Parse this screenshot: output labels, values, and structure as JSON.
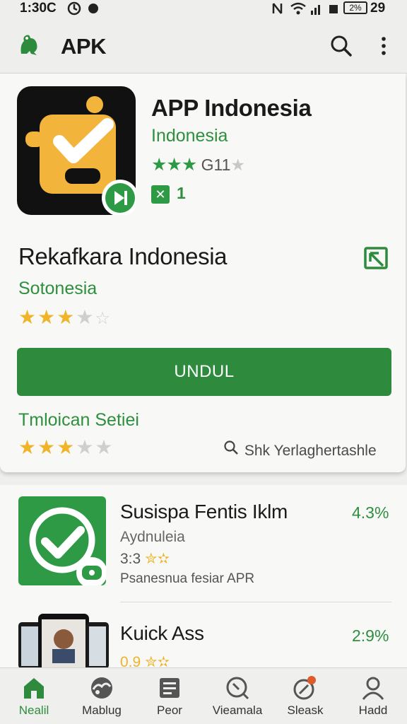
{
  "status_bar": {
    "time": "1:30C",
    "battery_text": "2%",
    "battery_level": "29"
  },
  "app_bar": {
    "title": "APK",
    "logo_icon": "frog-logo-icon",
    "search_icon": "search-icon",
    "more_icon": "more-vert-icon"
  },
  "featured": {
    "name": "APP Indonesia",
    "developer": "Indonesia",
    "rating_text": "G11",
    "installs": "1",
    "stars_filled": 3
  },
  "detail": {
    "title": "Rekafkara Indonesia",
    "subtitle": "Sotonesia",
    "rating": 3,
    "install_button": "UNDUL",
    "review_title": "Tmloican Setiei",
    "review_rating": 3,
    "search_note": "Shk Yerlaghertashle"
  },
  "list": [
    {
      "name": "Susispa Fentis Iklm",
      "percent": "4.3%",
      "developer": "Aydnuleia",
      "rating": "3:3",
      "meta": "Psanesnua fesiar APR"
    },
    {
      "name": "Kuick Ass",
      "percent": "2:9%",
      "rating": "0.9"
    }
  ],
  "bottom_nav": [
    {
      "label": "Nealil",
      "icon": "home-icon",
      "active": true
    },
    {
      "label": "Mablug",
      "icon": "games-icon",
      "active": false
    },
    {
      "label": "Peor",
      "icon": "news-icon",
      "active": false
    },
    {
      "label": "Vieamala",
      "icon": "explore-icon",
      "active": false
    },
    {
      "label": "Sleask",
      "icon": "rocket-icon",
      "active": false
    },
    {
      "label": "Hadd",
      "icon": "profile-icon",
      "active": false
    }
  ],
  "colors": {
    "accent": "#2e8b3d",
    "star": "#f0b429",
    "icon_yellow": "#f2b43a"
  }
}
